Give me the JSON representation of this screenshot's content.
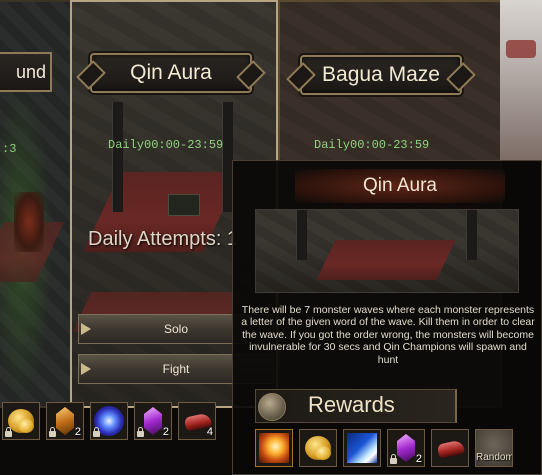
{
  "left_card": {
    "title_fragment": "und",
    "count_fragment": ":3"
  },
  "middle_card": {
    "title": "Qin Aura",
    "schedule": "Daily00:00-23:59",
    "attempts": "Daily Attempts: 1",
    "solo_label": "Solo",
    "fight_label": "Fight"
  },
  "right_card": {
    "title": "Bagua Maze",
    "schedule": "Daily00:00-23:59"
  },
  "bottom_rewards": [
    {
      "icon": "gold-coins-icon",
      "count": ""
    },
    {
      "icon": "amber-crystal-icon",
      "count": "2"
    },
    {
      "icon": "blue-orb-icon",
      "count": ""
    },
    {
      "icon": "purple-crystal-icon",
      "count": "2"
    },
    {
      "icon": "red-item-icon",
      "count": "4"
    }
  ],
  "tooltip": {
    "title": "Qin Aura",
    "description": "There will be 7 monster waves where each monster represents a letter of the given word of the wave. Kill them in order to clear the wave. If you got the order wrong, the monsters will become invulnerable for 30 secs and Qin Champions will spawn and hunt",
    "rewards_label": "Rewards",
    "rewards": [
      {
        "icon": "fire-skill-icon",
        "count": ""
      },
      {
        "icon": "gold-coins-icon",
        "count": ""
      },
      {
        "icon": "blue-comet-icon",
        "count": ""
      },
      {
        "icon": "purple-crystal-icon",
        "count": "2"
      },
      {
        "icon": "red-item-icon",
        "count": ""
      },
      {
        "icon": "random-icon",
        "label": "Random"
      }
    ]
  }
}
